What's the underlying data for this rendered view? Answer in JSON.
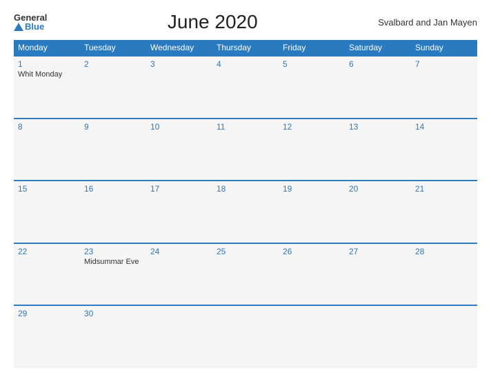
{
  "logo": {
    "general": "General",
    "blue": "Blue"
  },
  "header": {
    "title": "June 2020",
    "region": "Svalbard and Jan Mayen"
  },
  "weekdays": [
    "Monday",
    "Tuesday",
    "Wednesday",
    "Thursday",
    "Friday",
    "Saturday",
    "Sunday"
  ],
  "weeks": [
    [
      {
        "day": 1,
        "event": "Whit Monday"
      },
      {
        "day": 2,
        "event": ""
      },
      {
        "day": 3,
        "event": ""
      },
      {
        "day": 4,
        "event": ""
      },
      {
        "day": 5,
        "event": ""
      },
      {
        "day": 6,
        "event": ""
      },
      {
        "day": 7,
        "event": ""
      }
    ],
    [
      {
        "day": 8,
        "event": ""
      },
      {
        "day": 9,
        "event": ""
      },
      {
        "day": 10,
        "event": ""
      },
      {
        "day": 11,
        "event": ""
      },
      {
        "day": 12,
        "event": ""
      },
      {
        "day": 13,
        "event": ""
      },
      {
        "day": 14,
        "event": ""
      }
    ],
    [
      {
        "day": 15,
        "event": ""
      },
      {
        "day": 16,
        "event": ""
      },
      {
        "day": 17,
        "event": ""
      },
      {
        "day": 18,
        "event": ""
      },
      {
        "day": 19,
        "event": ""
      },
      {
        "day": 20,
        "event": ""
      },
      {
        "day": 21,
        "event": ""
      }
    ],
    [
      {
        "day": 22,
        "event": ""
      },
      {
        "day": 23,
        "event": "Midsummar Eve"
      },
      {
        "day": 24,
        "event": ""
      },
      {
        "day": 25,
        "event": ""
      },
      {
        "day": 26,
        "event": ""
      },
      {
        "day": 27,
        "event": ""
      },
      {
        "day": 28,
        "event": ""
      }
    ],
    [
      {
        "day": 29,
        "event": ""
      },
      {
        "day": 30,
        "event": ""
      },
      null,
      null,
      null,
      null,
      null
    ]
  ]
}
